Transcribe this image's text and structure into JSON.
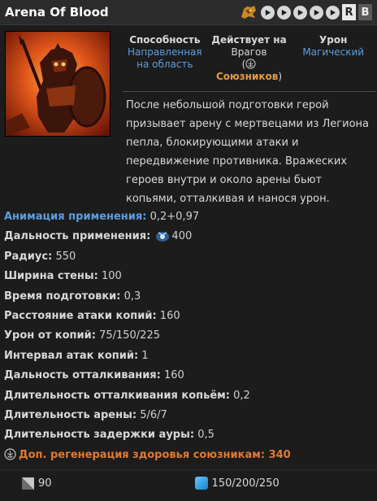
{
  "header": {
    "title": "Arena Of Blood",
    "hero_icon": "mars-hero-icon",
    "controls": [
      "play-icon",
      "play-icon",
      "play-icon",
      "play-icon",
      "play-icon"
    ],
    "r_label": "R",
    "b_label": "B"
  },
  "ability": {
    "image": "arena-of-blood-ability-icon",
    "properties": [
      {
        "label": "Способность",
        "value": "Направленная на область"
      },
      {
        "label": "Действует на",
        "value_prefix": "Врагов",
        "open_paren": "(",
        "team": "Союзников",
        "close_paren": ")"
      },
      {
        "label": "Урон",
        "value": "Магический"
      }
    ],
    "description": "После небольшой подготовки герой призывает арену с мертвецами из Легиона пепла, блокирующими атаки и передвижение противника. Вражеских героев внутри и около арены бьют копьями, отталкивая и нанося урон."
  },
  "stats": [
    {
      "key": "Анимация применения:",
      "value": "0,2+0,97",
      "highlight": "blue"
    },
    {
      "key": "Дальность применения:",
      "value": "400",
      "icon": "cast-range-icon"
    },
    {
      "key": "Радиус:",
      "value": "550"
    },
    {
      "key": "Ширина стены:",
      "value": "100"
    },
    {
      "key": "Время подготовки:",
      "value": "0,3"
    },
    {
      "key": "Расстояние атаки копий:",
      "value": "160"
    },
    {
      "key": "Урон от копий:",
      "value": "75/150/225"
    },
    {
      "key": "Интервал атак копий:",
      "value": "1"
    },
    {
      "key": "Дальность отталкивания:",
      "value": "160"
    },
    {
      "key": "Длительность отталкивания копьём:",
      "value": "0,2"
    },
    {
      "key": "Длительность арены:",
      "value": "5/6/7"
    },
    {
      "key": "Длительность задержки ауры:",
      "value": "0,5"
    }
  ],
  "aura": {
    "text": "Доп. регенерация здоровья союзникам:",
    "value": "340",
    "icon": "aura-heal-icon"
  },
  "footer": {
    "cooldown": "90",
    "cooldown_icon": "cooldown-icon",
    "mana": "150/200/250",
    "mana_icon": "mana-icon"
  },
  "colors": {
    "accent_blue": "#5b9ee0",
    "team_orange": "#e59a43",
    "aura_orange": "#e07a2e"
  }
}
